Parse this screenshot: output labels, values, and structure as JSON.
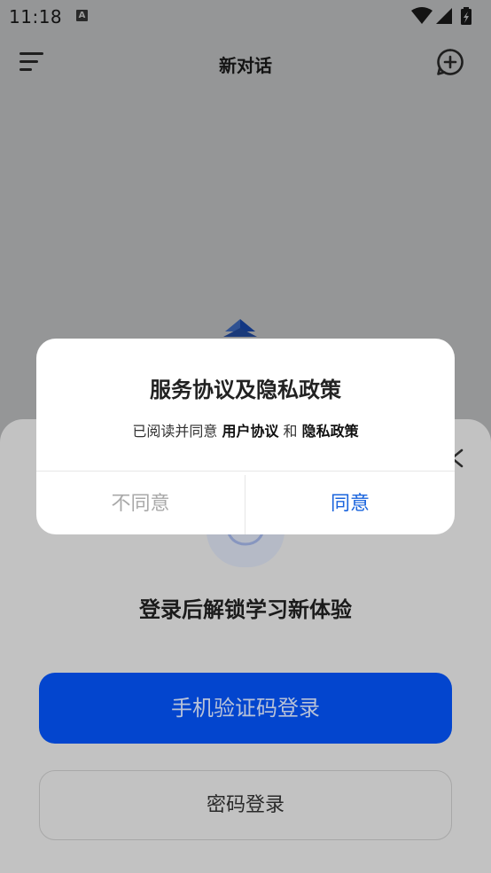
{
  "status_bar": {
    "time": "11:18",
    "notification_badge": "A",
    "icons": [
      "wifi-icon",
      "cellular-signal-icon",
      "battery-charging-icon"
    ]
  },
  "app_bar": {
    "title": "新对话",
    "menu_icon": "menu-icon",
    "new_chat_icon": "new-chat-icon"
  },
  "login_sheet": {
    "heading": "登录后解锁学习新体验",
    "phone_login_label": "手机验证码登录",
    "password_login_label": "密码登录",
    "close_icon": "close-icon"
  },
  "dialog": {
    "title": "服务协议及隐私政策",
    "body_prefix": "已阅读并同意",
    "user_agreement_link": "用户协议",
    "connector": "和",
    "privacy_policy_link": "隐私政策",
    "disagree_label": "不同意",
    "agree_label": "同意"
  },
  "colors": {
    "primary_button": "#0345ce",
    "agree_text": "#1a64dd",
    "disagree_text": "#a9a9a9",
    "overlay": "rgba(0,0,0,0.39)"
  }
}
